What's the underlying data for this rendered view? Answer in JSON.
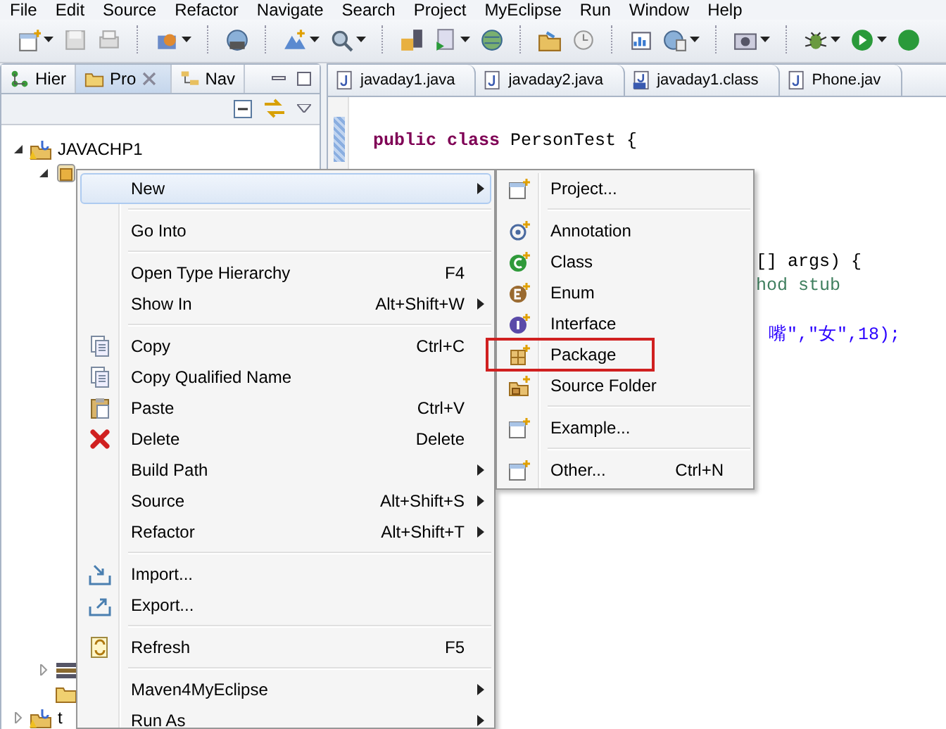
{
  "menubar": [
    "File",
    "Edit",
    "Source",
    "Refactor",
    "Navigate",
    "Search",
    "Project",
    "MyEclipse",
    "Run",
    "Window",
    "Help"
  ],
  "left_view": {
    "tabs": [
      {
        "label": "Hier",
        "selected": false
      },
      {
        "label": "Pro",
        "selected": true
      },
      {
        "label": "Nav",
        "selected": false
      }
    ],
    "tree": [
      {
        "label": "JAVACHP1",
        "kind": "project",
        "expanded": true,
        "children": [
          {
            "kind": "package",
            "expanded": true
          }
        ]
      },
      {
        "kind": "library",
        "expanded": false
      },
      {
        "kind": "folder"
      },
      {
        "label": "t",
        "kind": "project",
        "expanded": false
      }
    ]
  },
  "editor": {
    "tabs": [
      {
        "label": "javaday1.java",
        "kind": "java",
        "selected": false
      },
      {
        "label": "javaday2.java",
        "kind": "java",
        "selected": false
      },
      {
        "label": "javaday1.class",
        "kind": "class",
        "selected": false
      },
      {
        "label": "Phone.jav",
        "kind": "java",
        "selected": false
      }
    ],
    "lines": [
      {
        "kind": "blank"
      },
      {
        "kind": "full",
        "keyword": "public class",
        "text": "PersonTest {"
      },
      {
        "kind": "blank"
      },
      {
        "kind": "blank"
      },
      {
        "kind": "blank"
      },
      {
        "kind": "blank"
      },
      {
        "kind": "tail",
        "text": "[] args) {"
      },
      {
        "kind": "comment",
        "text": "hod stub"
      },
      {
        "kind": "blank"
      },
      {
        "kind": "string",
        "text": "嘴\",\"女\",18);"
      }
    ]
  },
  "context_menu": [
    {
      "label": "New",
      "kind": "plain",
      "submenu": true,
      "selected": true
    },
    {
      "kind": "separator"
    },
    {
      "label": "Go Into",
      "kind": "plain",
      "selected": false
    },
    {
      "kind": "separator"
    },
    {
      "label": "Open Type Hierarchy",
      "shortcut": "F4",
      "kind": "plain",
      "selected": false
    },
    {
      "label": "Show In",
      "shortcut": "Alt+Shift+W",
      "submenu": true,
      "kind": "plain",
      "selected": false
    },
    {
      "kind": "separator"
    },
    {
      "label": "Copy",
      "shortcut": "Ctrl+C",
      "kind": "copy",
      "selected": false
    },
    {
      "label": "Copy Qualified Name",
      "kind": "copy",
      "selected": false
    },
    {
      "label": "Paste",
      "shortcut": "Ctrl+V",
      "kind": "paste",
      "selected": false
    },
    {
      "label": "Delete",
      "shortcut": "Delete",
      "kind": "delete",
      "selected": false
    },
    {
      "label": "Build Path",
      "submenu": true,
      "kind": "plain",
      "selected": false
    },
    {
      "label": "Source",
      "shortcut": "Alt+Shift+S",
      "submenu": true,
      "kind": "plain",
      "selected": false
    },
    {
      "label": "Refactor",
      "shortcut": "Alt+Shift+T",
      "submenu": true,
      "kind": "plain",
      "selected": false
    },
    {
      "kind": "separator"
    },
    {
      "label": "Import...",
      "kind": "import",
      "selected": false
    },
    {
      "label": "Export...",
      "kind": "export",
      "selected": false
    },
    {
      "kind": "separator"
    },
    {
      "label": "Refresh",
      "shortcut": "F5",
      "kind": "refresh",
      "selected": false
    },
    {
      "kind": "separator"
    },
    {
      "label": "Maven4MyEclipse",
      "submenu": true,
      "kind": "plain",
      "selected": false
    },
    {
      "label": "Run As",
      "submenu": true,
      "kind": "plain",
      "selected": false
    }
  ],
  "submenu": [
    {
      "label": "Project...",
      "kind": "wizard",
      "highlighted": false
    },
    {
      "kind": "separator"
    },
    {
      "label": "Annotation",
      "kind": "annotation",
      "highlighted": false
    },
    {
      "label": "Class",
      "kind": "class",
      "highlighted": false
    },
    {
      "label": "Enum",
      "kind": "enum",
      "highlighted": false
    },
    {
      "label": "Interface",
      "kind": "interface",
      "highlighted": false
    },
    {
      "label": "Package",
      "kind": "package",
      "highlighted": true
    },
    {
      "label": "Source Folder",
      "kind": "source-folder",
      "highlighted": false
    },
    {
      "kind": "separator"
    },
    {
      "label": "Example...",
      "kind": "wizard",
      "highlighted": false
    },
    {
      "kind": "separator"
    },
    {
      "label": "Other...",
      "shortcut": "Ctrl+N",
      "kind": "wizard",
      "highlighted": false
    }
  ]
}
